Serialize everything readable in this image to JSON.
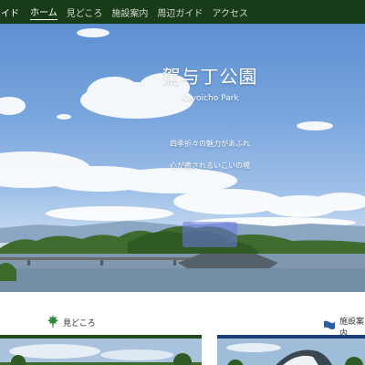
{
  "nav": {
    "brand": "イド",
    "items": [
      {
        "label": "ホーム",
        "active": true
      },
      {
        "label": "見どころ",
        "active": false
      },
      {
        "label": "施設案内",
        "active": false
      },
      {
        "label": "周辺ガイド",
        "active": false
      },
      {
        "label": "アクセス",
        "active": false
      }
    ]
  },
  "hero": {
    "title": "駕与丁公園",
    "subtitle": "Kayoicho Park",
    "tagline_1": "四季折々の魅力があふれ",
    "tagline_2": "心が癒されるいこいの場"
  },
  "sections": [
    {
      "label": "見どころ",
      "icon": "maple-leaf-icon"
    },
    {
      "label": "施設案内",
      "icon": "flag-icon"
    }
  ],
  "colors": {
    "nav_background": "#173c17",
    "nav_text": "#ffffff",
    "card_1_accent": "#1e4a1e",
    "card_2_accent": "#1c3d7a",
    "leaf_icon": "#2e8b3a",
    "flag_icon": "#2a5fa8"
  }
}
